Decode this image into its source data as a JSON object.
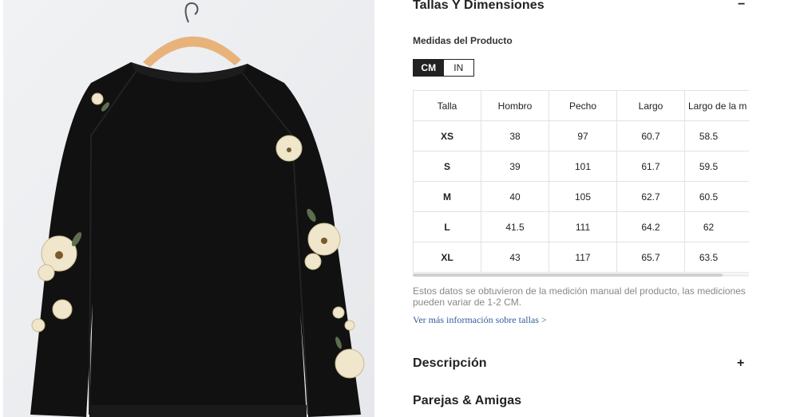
{
  "product": {
    "image_alt": "Black raglan sweatshirt with floral sleeves on hanger"
  },
  "size_section": {
    "title": "Tallas Y Dimensiones",
    "toggle": "−",
    "subtitle": "Medidas del Producto",
    "units": [
      "CM",
      "IN"
    ],
    "active_unit": "CM",
    "columns": [
      "Talla",
      "Hombro",
      "Pecho",
      "Largo",
      "Largo de la m"
    ],
    "rows": [
      {
        "size": "XS",
        "hombro": "38",
        "pecho": "97",
        "largo": "60.7",
        "largo_m": "58.5"
      },
      {
        "size": "S",
        "hombro": "39",
        "pecho": "101",
        "largo": "61.7",
        "largo_m": "59.5"
      },
      {
        "size": "M",
        "hombro": "40",
        "pecho": "105",
        "largo": "62.7",
        "largo_m": "60.5"
      },
      {
        "size": "L",
        "hombro": "41.5",
        "pecho": "111",
        "largo": "64.2",
        "largo_m": "62"
      },
      {
        "size": "XL",
        "hombro": "43",
        "pecho": "117",
        "largo": "65.7",
        "largo_m": "63.5"
      }
    ],
    "note": "Estos datos se obtuvieron de la medición manual del producto, las mediciones pueden variar de 1-2 CM.",
    "more_link": "Ver más información sobre tallas >"
  },
  "description_section": {
    "title": "Descripción",
    "toggle": "+"
  },
  "pairs_section": {
    "title": "Parejas & Amigas"
  },
  "colors": {
    "accent": "#222222",
    "link": "#2f5f9e",
    "note": "#888888",
    "border": "#e2e2e2"
  }
}
